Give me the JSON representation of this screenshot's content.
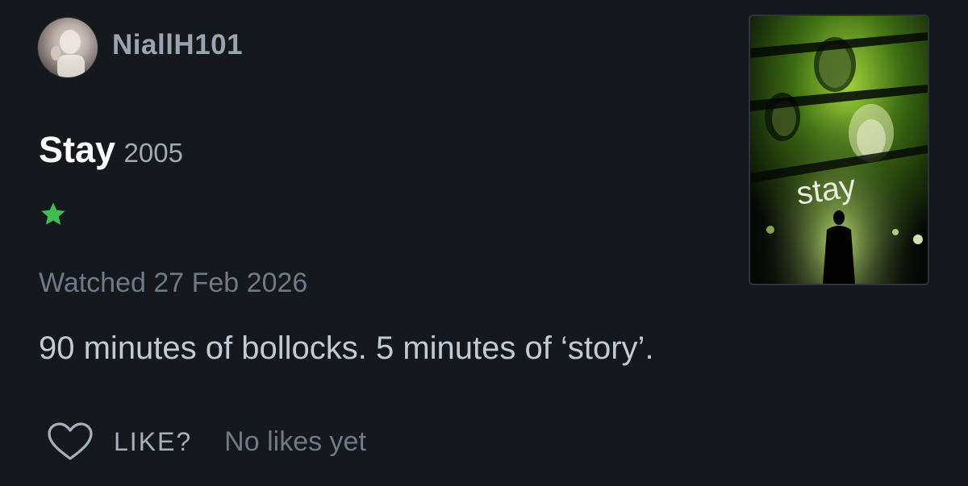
{
  "user": {
    "username": "NiallH101"
  },
  "film": {
    "title": "Stay",
    "year": "2005",
    "rating_stars": 1,
    "poster_title": "stay"
  },
  "watched": {
    "label": "Watched 27 Feb 2026"
  },
  "review": {
    "text": "90 minutes of bollocks. 5 minutes of ‘story’."
  },
  "like": {
    "label": "LIKE?",
    "count_text": "No likes yet"
  },
  "colors": {
    "background": "#15181d",
    "star": "#40bc51",
    "username": "#9aa5b1"
  }
}
